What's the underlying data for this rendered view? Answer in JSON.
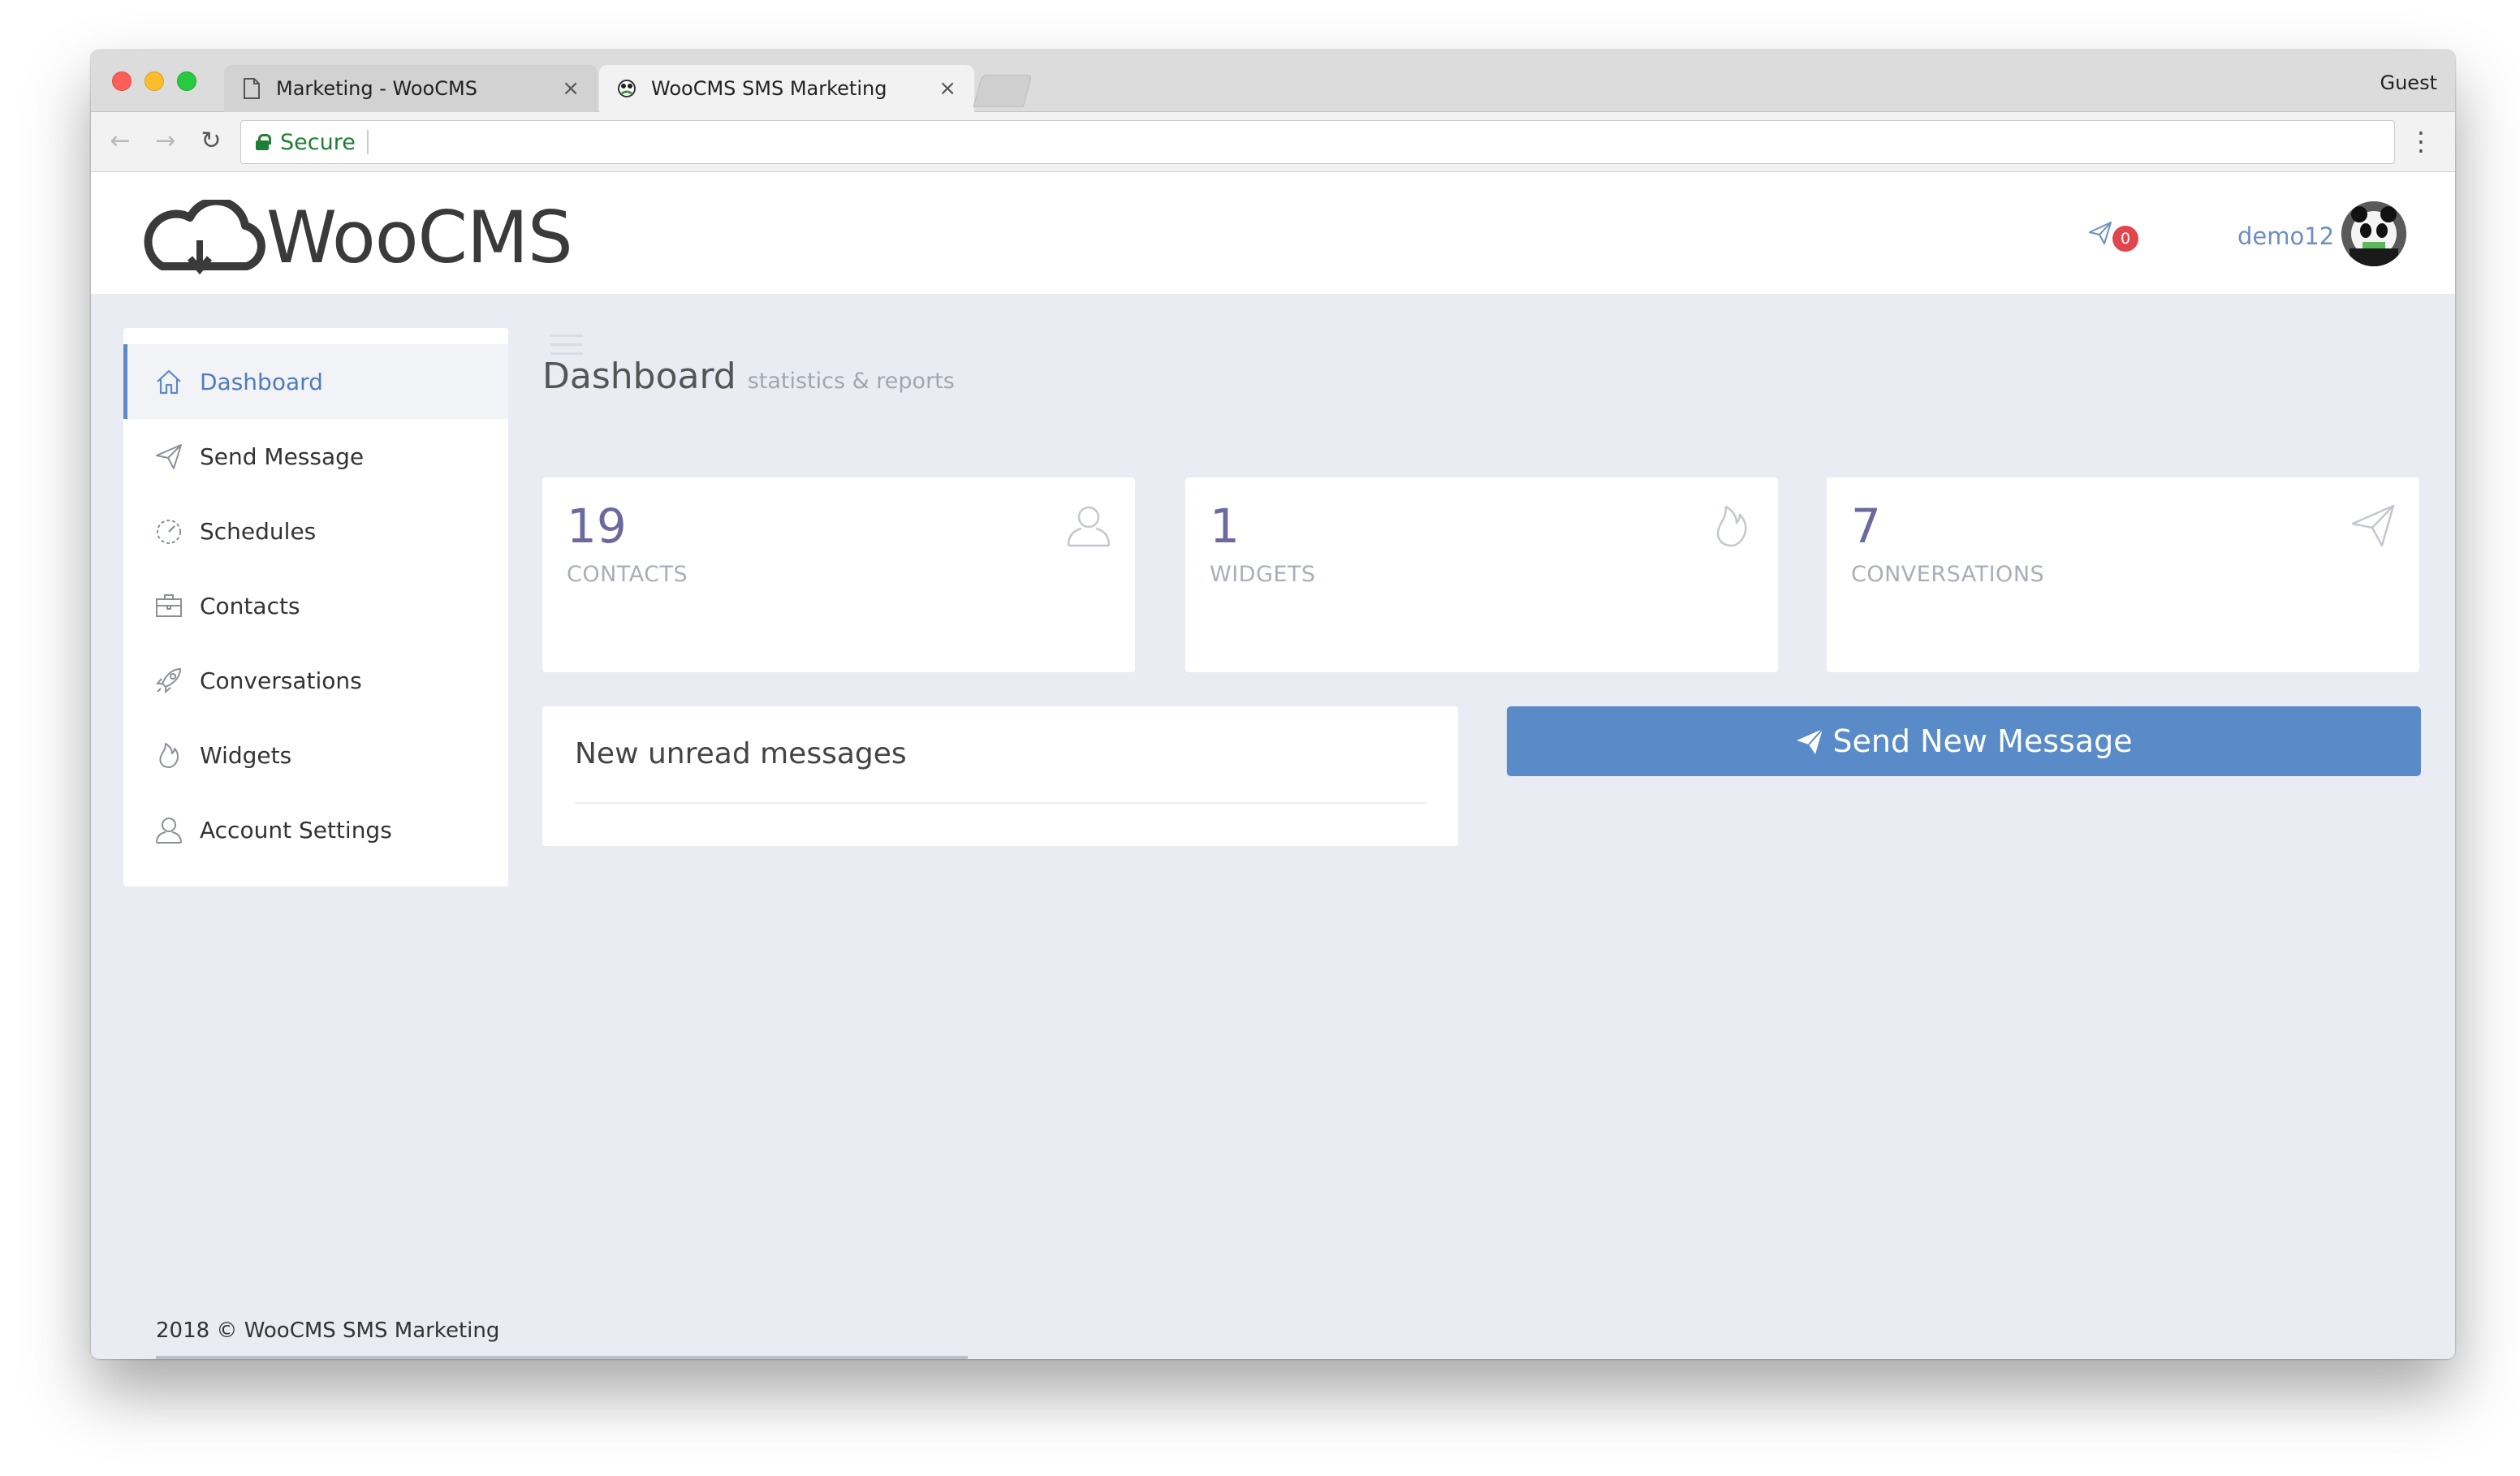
{
  "browser": {
    "tabs": [
      {
        "title": "Marketing - WooCMS",
        "close": "×"
      },
      {
        "title": "WooCMS SMS Marketing",
        "close": "×"
      }
    ],
    "profile": "Guest",
    "nav": {
      "back": "←",
      "forward": "→",
      "reload": "↻",
      "menu": "⋮"
    },
    "address": {
      "secure_label": "Secure"
    }
  },
  "header": {
    "logo_text": "WooCMS",
    "notification_count": "0",
    "username": "demo12"
  },
  "sidebar": {
    "items": [
      {
        "label": "Dashboard",
        "icon": "home-icon",
        "active": true
      },
      {
        "label": "Send Message",
        "icon": "paper-plane-icon"
      },
      {
        "label": "Schedules",
        "icon": "speedometer-icon"
      },
      {
        "label": "Contacts",
        "icon": "briefcase-icon"
      },
      {
        "label": "Conversations",
        "icon": "rocket-icon"
      },
      {
        "label": "Widgets",
        "icon": "fire-icon"
      },
      {
        "label": "Account Settings",
        "icon": "user-icon"
      }
    ]
  },
  "main": {
    "title": "Dashboard",
    "subtitle": "statistics & reports",
    "stats": [
      {
        "value": "19",
        "label": "CONTACTS",
        "icon": "user-icon"
      },
      {
        "value": "1",
        "label": "WIDGETS",
        "icon": "fire-icon"
      },
      {
        "value": "7",
        "label": "CONVERSATIONS",
        "icon": "paper-plane-icon"
      }
    ],
    "unread_panel_title": "New unread messages",
    "send_button_label": "Send New Message"
  },
  "footer": {
    "copyright": "2018 © WooCMS SMS Marketing"
  },
  "colors": {
    "accent": "#588bc8",
    "stat_number": "#6b6a9e",
    "badge": "#e0464c",
    "page_bg": "#e9ecf3"
  }
}
